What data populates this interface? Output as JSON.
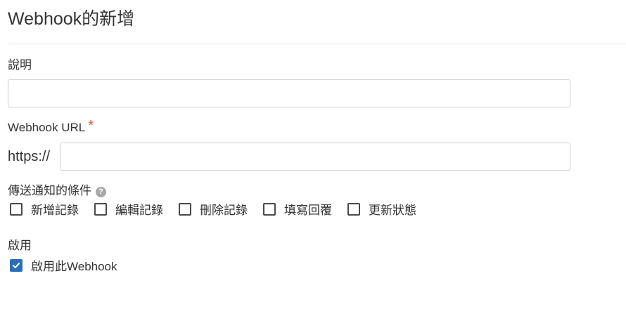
{
  "page": {
    "title": "Webhook的新增"
  },
  "form": {
    "description_label": "說明",
    "description_value": "",
    "url_label": "Webhook URL",
    "url_required_mark": "*",
    "url_prefix": "https://",
    "url_value": "",
    "conditions_label": "傳送通知的條件",
    "help_icon_glyph": "?",
    "conditions": [
      {
        "label": "新增記錄",
        "checked": false
      },
      {
        "label": "編輯記錄",
        "checked": false
      },
      {
        "label": "刪除記錄",
        "checked": false
      },
      {
        "label": "填寫回覆",
        "checked": false
      },
      {
        "label": "更新狀態",
        "checked": false
      }
    ],
    "enable_section_label": "啟用",
    "enable_checkbox_label": "啟用此Webhook",
    "enable_checked": true
  },
  "colors": {
    "required": "#e74c3c",
    "checkbox_checked": "#2a6ebb",
    "border": "#cfcfcf"
  }
}
